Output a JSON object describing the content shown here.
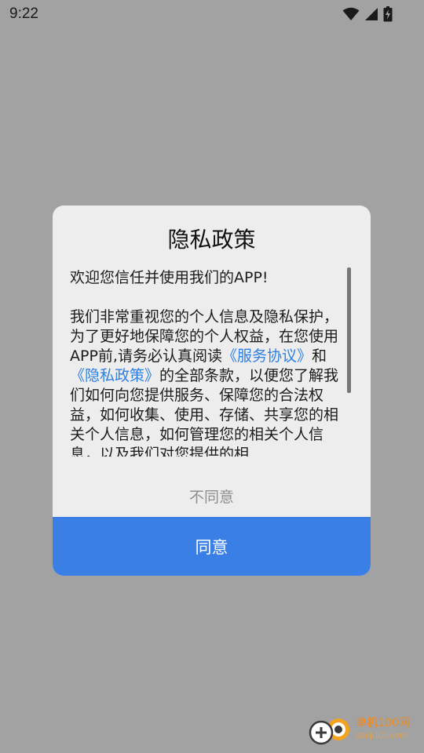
{
  "status_bar": {
    "time": "9:22",
    "icons": [
      "wifi-icon",
      "cellular-signal-icon",
      "battery-charging-icon"
    ]
  },
  "dialog": {
    "title": "隐私政策",
    "intro": "欢迎您信任并使用我们的APP!",
    "body_part1": " 我们非常重视您的个人信息及隐私保护，为了更好地保障您的个人权益，在您使用APP前,请务必认真阅读",
    "service_link": "《服务协议》",
    "body_and": "和",
    "privacy_link": "《隐私政策》",
    "body_part2": "的全部条款，以便您了解我们如何向您提供服务、保障您的合法权益，如何收集、使用、存储、共享您的相关个人信息，如何管理您的相关个人信息，以及我们对您提供的相",
    "disagree_label": "不同意",
    "agree_label": "同意"
  },
  "watermark": {
    "main": "单机100网",
    "sub": "danji100.com"
  },
  "colors": {
    "overlay": "#a2a2a2",
    "dialog_bg": "#ededed",
    "accent": "#3a7fe6",
    "link": "#2f7fe0"
  }
}
